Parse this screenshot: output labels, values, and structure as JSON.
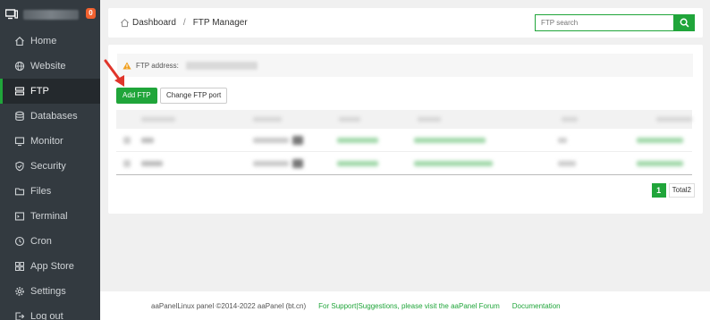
{
  "sidebar": {
    "badge": "0",
    "items": [
      {
        "label": "Home",
        "icon": "home-icon"
      },
      {
        "label": "Website",
        "icon": "globe-icon"
      },
      {
        "label": "FTP",
        "icon": "ftp-icon",
        "active": true
      },
      {
        "label": "Databases",
        "icon": "database-icon"
      },
      {
        "label": "Monitor",
        "icon": "monitor-icon"
      },
      {
        "label": "Security",
        "icon": "shield-icon"
      },
      {
        "label": "Files",
        "icon": "folder-icon"
      },
      {
        "label": "Terminal",
        "icon": "terminal-icon"
      },
      {
        "label": "Cron",
        "icon": "clock-icon"
      },
      {
        "label": "App Store",
        "icon": "grid-icon"
      },
      {
        "label": "Settings",
        "icon": "gear-icon"
      },
      {
        "label": "Log out",
        "icon": "logout-icon"
      }
    ]
  },
  "breadcrumb": {
    "home": "Dashboard",
    "separator": "/",
    "current": "FTP Manager"
  },
  "search": {
    "placeholder": "FTP search"
  },
  "ftp": {
    "address_label": "FTP address:",
    "add_label": "Add FTP",
    "port_label": "Change FTP port"
  },
  "pagination": {
    "page": "1",
    "total": "Total2"
  },
  "footer": {
    "copyright": "aaPanelLinux panel ©2014-2022 aaPanel (bt.cn)",
    "support": "For Support|Suggestions, please visit the aaPanel Forum",
    "docs": "Documentation"
  },
  "colors": {
    "accent": "#20a53a",
    "sidebar_bg": "#333a40",
    "badge": "#f0612f",
    "arrow": "#e0352b"
  }
}
